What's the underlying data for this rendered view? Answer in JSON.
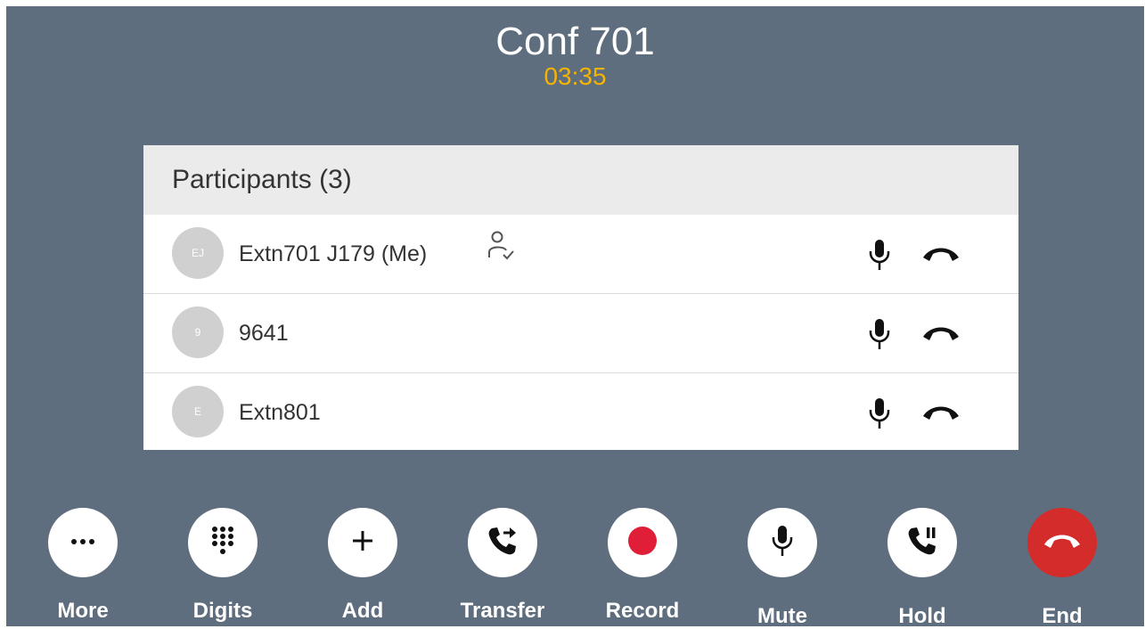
{
  "call": {
    "title": "Conf 701",
    "timer": "03:35",
    "timer_color": "#f5b400",
    "background_color": "#5f6e7e"
  },
  "participants": {
    "header": "Participants (3)",
    "items": [
      {
        "initials": "EJ",
        "name": "Extn701 J179 (Me)",
        "moderator_icon": "person-check-icon",
        "mic_icon": "microphone-icon",
        "hangup_icon": "phone-hangup-icon"
      },
      {
        "initials": "9",
        "name": "9641",
        "mic_icon": "microphone-icon",
        "hangup_icon": "phone-hangup-icon"
      },
      {
        "initials": "E",
        "name": "Extn801",
        "mic_icon": "microphone-icon",
        "hangup_icon": "phone-hangup-icon"
      }
    ]
  },
  "toolbar": {
    "more": {
      "label": "More",
      "icon": "ellipsis-icon"
    },
    "digits": {
      "label": "Digits",
      "icon": "dialpad-icon"
    },
    "add": {
      "label": "Add",
      "icon": "plus-icon"
    },
    "transfer": {
      "label": "Transfer",
      "icon": "phone-forward-icon"
    },
    "record": {
      "label": "Record",
      "icon": "record-dot-icon",
      "color": "#e01e37"
    },
    "mute": {
      "label": "Mute",
      "icon": "microphone-icon"
    },
    "hold": {
      "label": "Hold",
      "icon": "phone-pause-icon"
    },
    "end": {
      "label": "End",
      "icon": "phone-hangup-icon",
      "color": "#d42b2b"
    }
  }
}
